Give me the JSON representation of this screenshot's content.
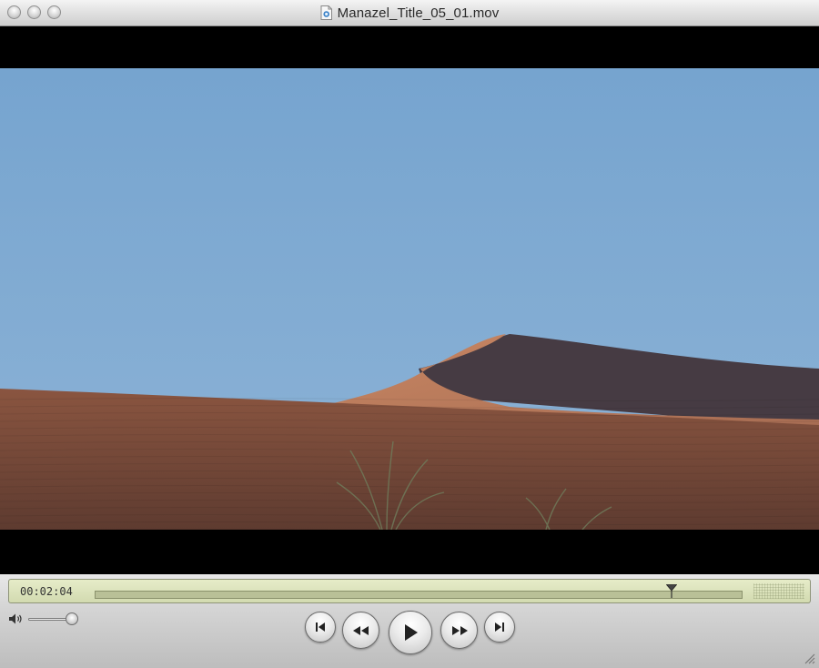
{
  "window": {
    "title": "Manazel_Title_05_01.mov",
    "document_icon": "quicktime-doc-icon"
  },
  "controller": {
    "timecode": "00:02:04",
    "playhead_progress": 0.89,
    "volume_level": 1.0,
    "buttons": {
      "go_to_start": "skip-to-start-icon",
      "rewind": "rewind-icon",
      "play": "play-icon",
      "fast_forward": "fast-forward-icon",
      "go_to_end": "skip-to-end-icon"
    }
  },
  "colors": {
    "sky": "#7fa9cf",
    "sand": "#7e4d3a",
    "lcd": "#dde3bd"
  }
}
